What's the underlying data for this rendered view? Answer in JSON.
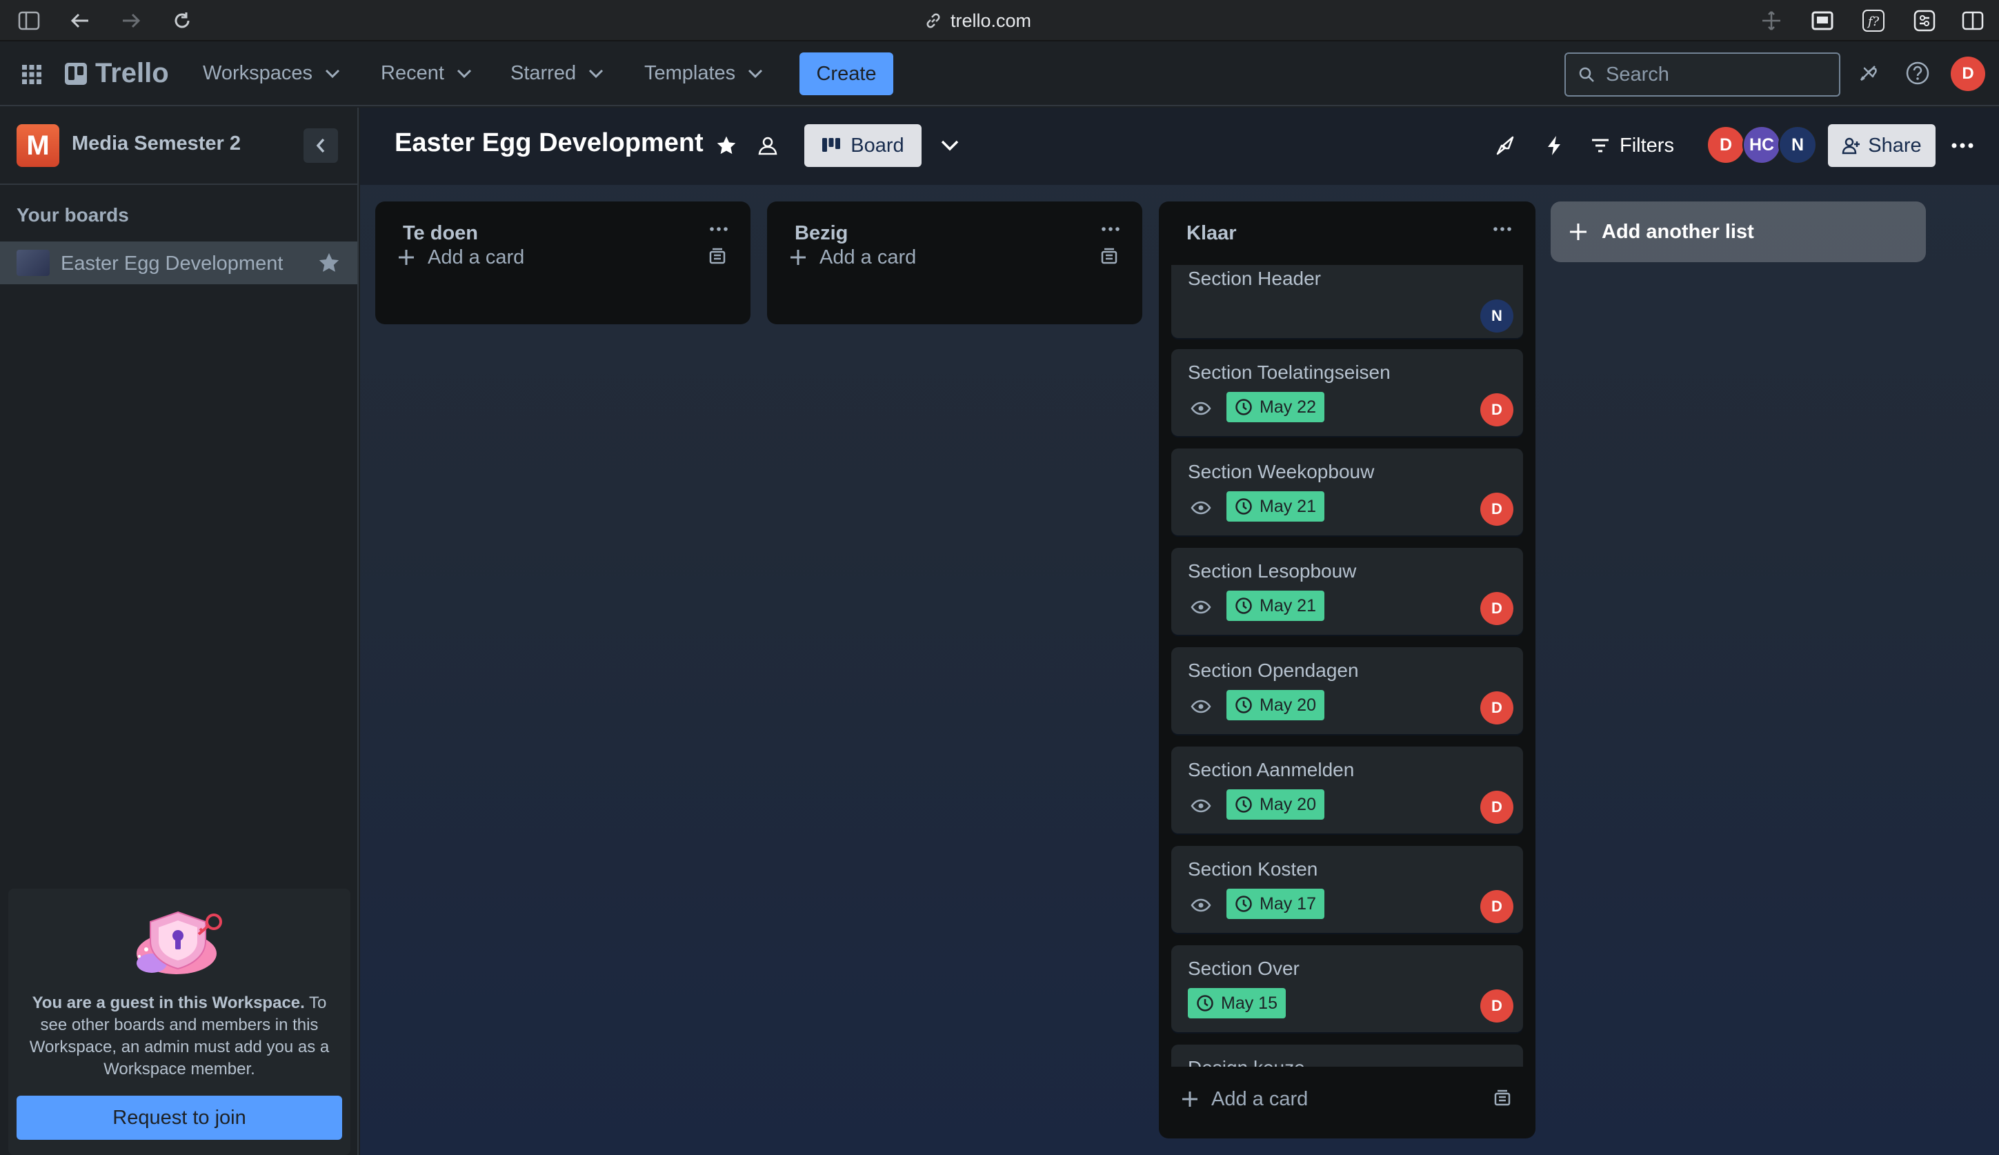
{
  "browser": {
    "url": "trello.com"
  },
  "header": {
    "logo": "Trello",
    "nav": [
      {
        "label": "Workspaces"
      },
      {
        "label": "Recent"
      },
      {
        "label": "Starred"
      },
      {
        "label": "Templates"
      }
    ],
    "create_label": "Create",
    "search_placeholder": "Search",
    "user_initial": "D"
  },
  "sidebar": {
    "workspace_initial": "M",
    "workspace_name": "Media Semester 2",
    "your_boards_label": "Your boards",
    "boards": [
      {
        "name": "Easter Egg Development"
      }
    ],
    "guest_notice": {
      "title": "You are a guest in this Workspace.",
      "body": "To see other boards and members in this Workspace, an admin must add you as a Workspace member.",
      "button": "Request to join"
    }
  },
  "board": {
    "title": "Easter Egg Development",
    "view_label": "Board",
    "filters_label": "Filters",
    "share_label": "Share",
    "members": [
      {
        "initials": "D",
        "color": "#e2483d"
      },
      {
        "initials": "HC",
        "color": "#5e4db2"
      },
      {
        "initials": "N",
        "color": "#1f3566"
      }
    ],
    "add_list_label": "Add another list",
    "lists": [
      {
        "title": "Te doen",
        "add_card_label": "Add a card",
        "cards": []
      },
      {
        "title": "Bezig",
        "add_card_label": "Add a card",
        "cards": []
      },
      {
        "title": "Klaar",
        "add_card_label": "Add a card",
        "cards": [
          {
            "title": "Section Header",
            "member": "N",
            "member_color": "#1f3566",
            "due": "",
            "watch": false
          },
          {
            "title": "Section Toelatingseisen",
            "member": "D",
            "member_color": "#e2483d",
            "due": "May 22",
            "watch": true
          },
          {
            "title": "Section Weekopbouw",
            "member": "D",
            "member_color": "#e2483d",
            "due": "May 21",
            "watch": true
          },
          {
            "title": "Section Lesopbouw",
            "member": "D",
            "member_color": "#e2483d",
            "due": "May 21",
            "watch": true
          },
          {
            "title": "Section Opendagen",
            "member": "D",
            "member_color": "#e2483d",
            "due": "May 20",
            "watch": true
          },
          {
            "title": "Section Aanmelden",
            "member": "D",
            "member_color": "#e2483d",
            "due": "May 20",
            "watch": true
          },
          {
            "title": "Section Kosten",
            "member": "D",
            "member_color": "#e2483d",
            "due": "May 17",
            "watch": true
          },
          {
            "title": "Section Over",
            "member": "D",
            "member_color": "#e2483d",
            "due": "May 15",
            "watch": false
          },
          {
            "title": "Design keuze",
            "member": "",
            "due": "",
            "watch": false
          }
        ]
      }
    ]
  }
}
